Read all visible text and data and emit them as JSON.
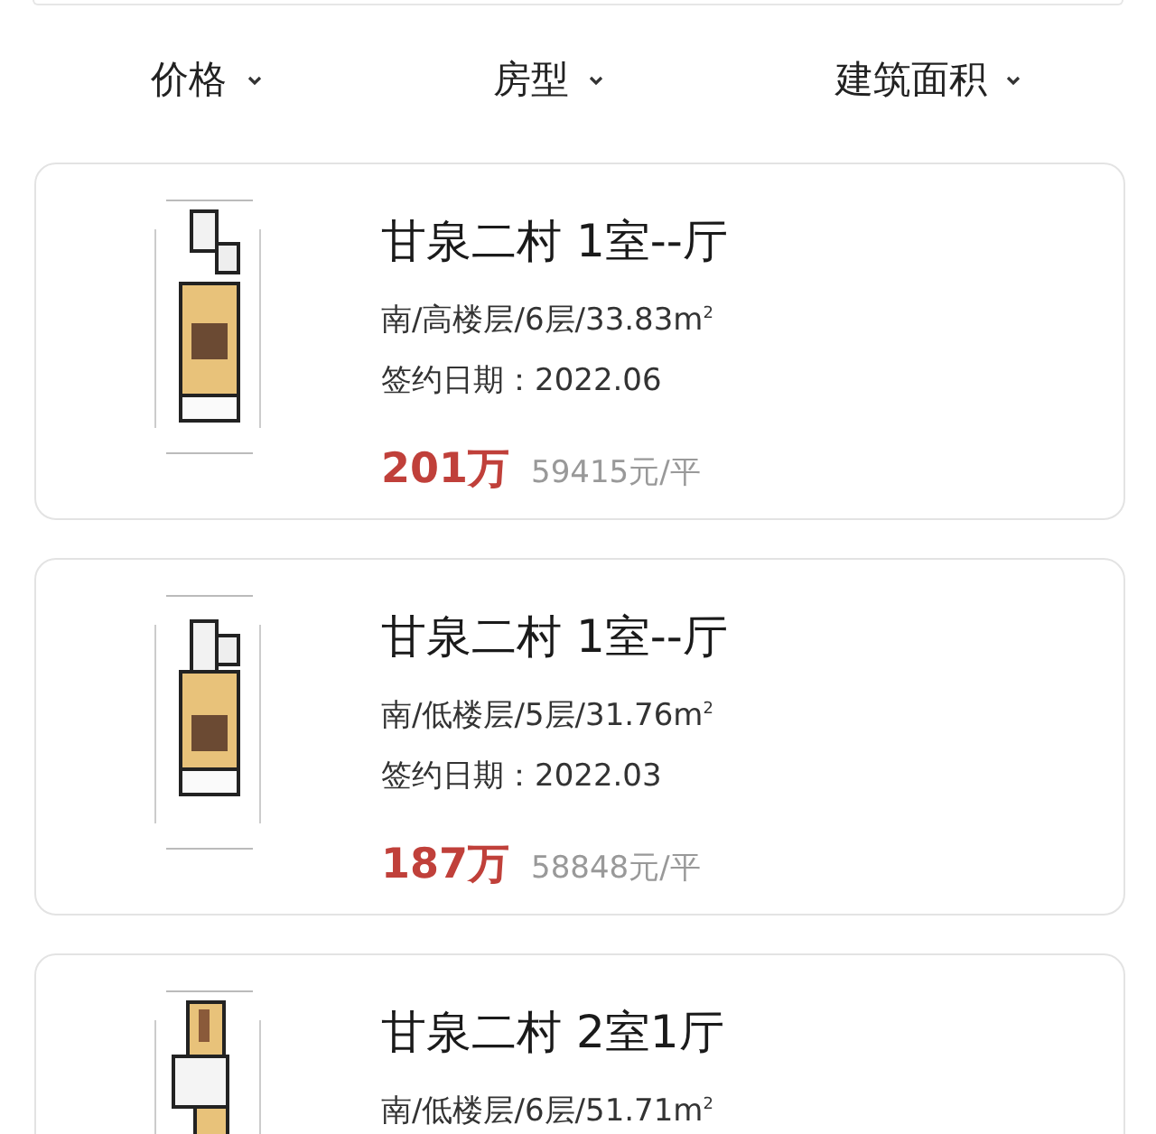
{
  "filters": [
    {
      "label": "价格"
    },
    {
      "label": "房型"
    },
    {
      "label": "建筑面积"
    }
  ],
  "listings": [
    {
      "title": "甘泉二村 1室--厅",
      "details": "南/高楼层/6层/33.83m$^{2}$",
      "date": "签约日期：2022.06",
      "price": "201万",
      "unit_price": "59415元/平"
    },
    {
      "title": "甘泉二村 1室--厅",
      "details": "南/低楼层/5层/31.76m$^{2}$",
      "date": "签约日期：2022.03",
      "price": "187万",
      "unit_price": "58848元/平"
    },
    {
      "title": "甘泉二村 2室1厅",
      "details": "南/低楼层/6层/51.71m$^{2}$"
    }
  ]
}
